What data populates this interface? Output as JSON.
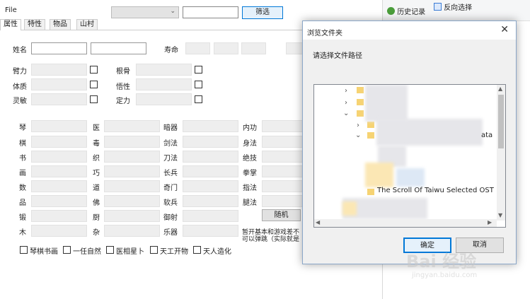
{
  "menu": {
    "file_label": "File"
  },
  "toolbar": {
    "filter_button": "筛选",
    "combo_value": "",
    "text_value": ""
  },
  "tabs": [
    "属性",
    "特性",
    "物品",
    "山村"
  ],
  "form": {
    "name_label": "姓名",
    "lifespan_label": "寿命",
    "attrs_left": [
      "臂力",
      "体质",
      "灵敏"
    ],
    "attrs_right": [
      "根骨",
      "悟性",
      "定力"
    ]
  },
  "skills": {
    "col1": [
      "琴",
      "棋",
      "书",
      "画",
      "数",
      "品",
      "锻",
      "木"
    ],
    "col2": [
      "医",
      "毒",
      "织",
      "巧",
      "道",
      "佛",
      "厨",
      "杂"
    ],
    "col3": [
      "暗器",
      "剑法",
      "刀法",
      "长兵",
      "奇门",
      "软兵",
      "御射",
      "乐器"
    ],
    "col4": [
      "内功",
      "身法",
      "绝技",
      "拳掌",
      "指法",
      "腿法"
    ]
  },
  "random_button": "随机",
  "note_text": [
    "暂开基本和游戏差不",
    "可以弹跳（实际就是"
  ],
  "bottom_checks": [
    "琴棋书画",
    "一任自然",
    "医相星卜",
    "天工开物",
    "天人造化"
  ],
  "right_panel": {
    "history": "历史记录",
    "reverse_select": "反向选择"
  },
  "dialog": {
    "title": "浏览文件夹",
    "prompt": "请选择文件路径",
    "tree_item_visible": "The Scroll Of Taiwu Selected OST",
    "tree_item_partial": "ata",
    "ok": "确定",
    "cancel": "取消"
  },
  "watermark": {
    "brand": "Bai 经验",
    "url": "jingyan.baidu.com"
  }
}
